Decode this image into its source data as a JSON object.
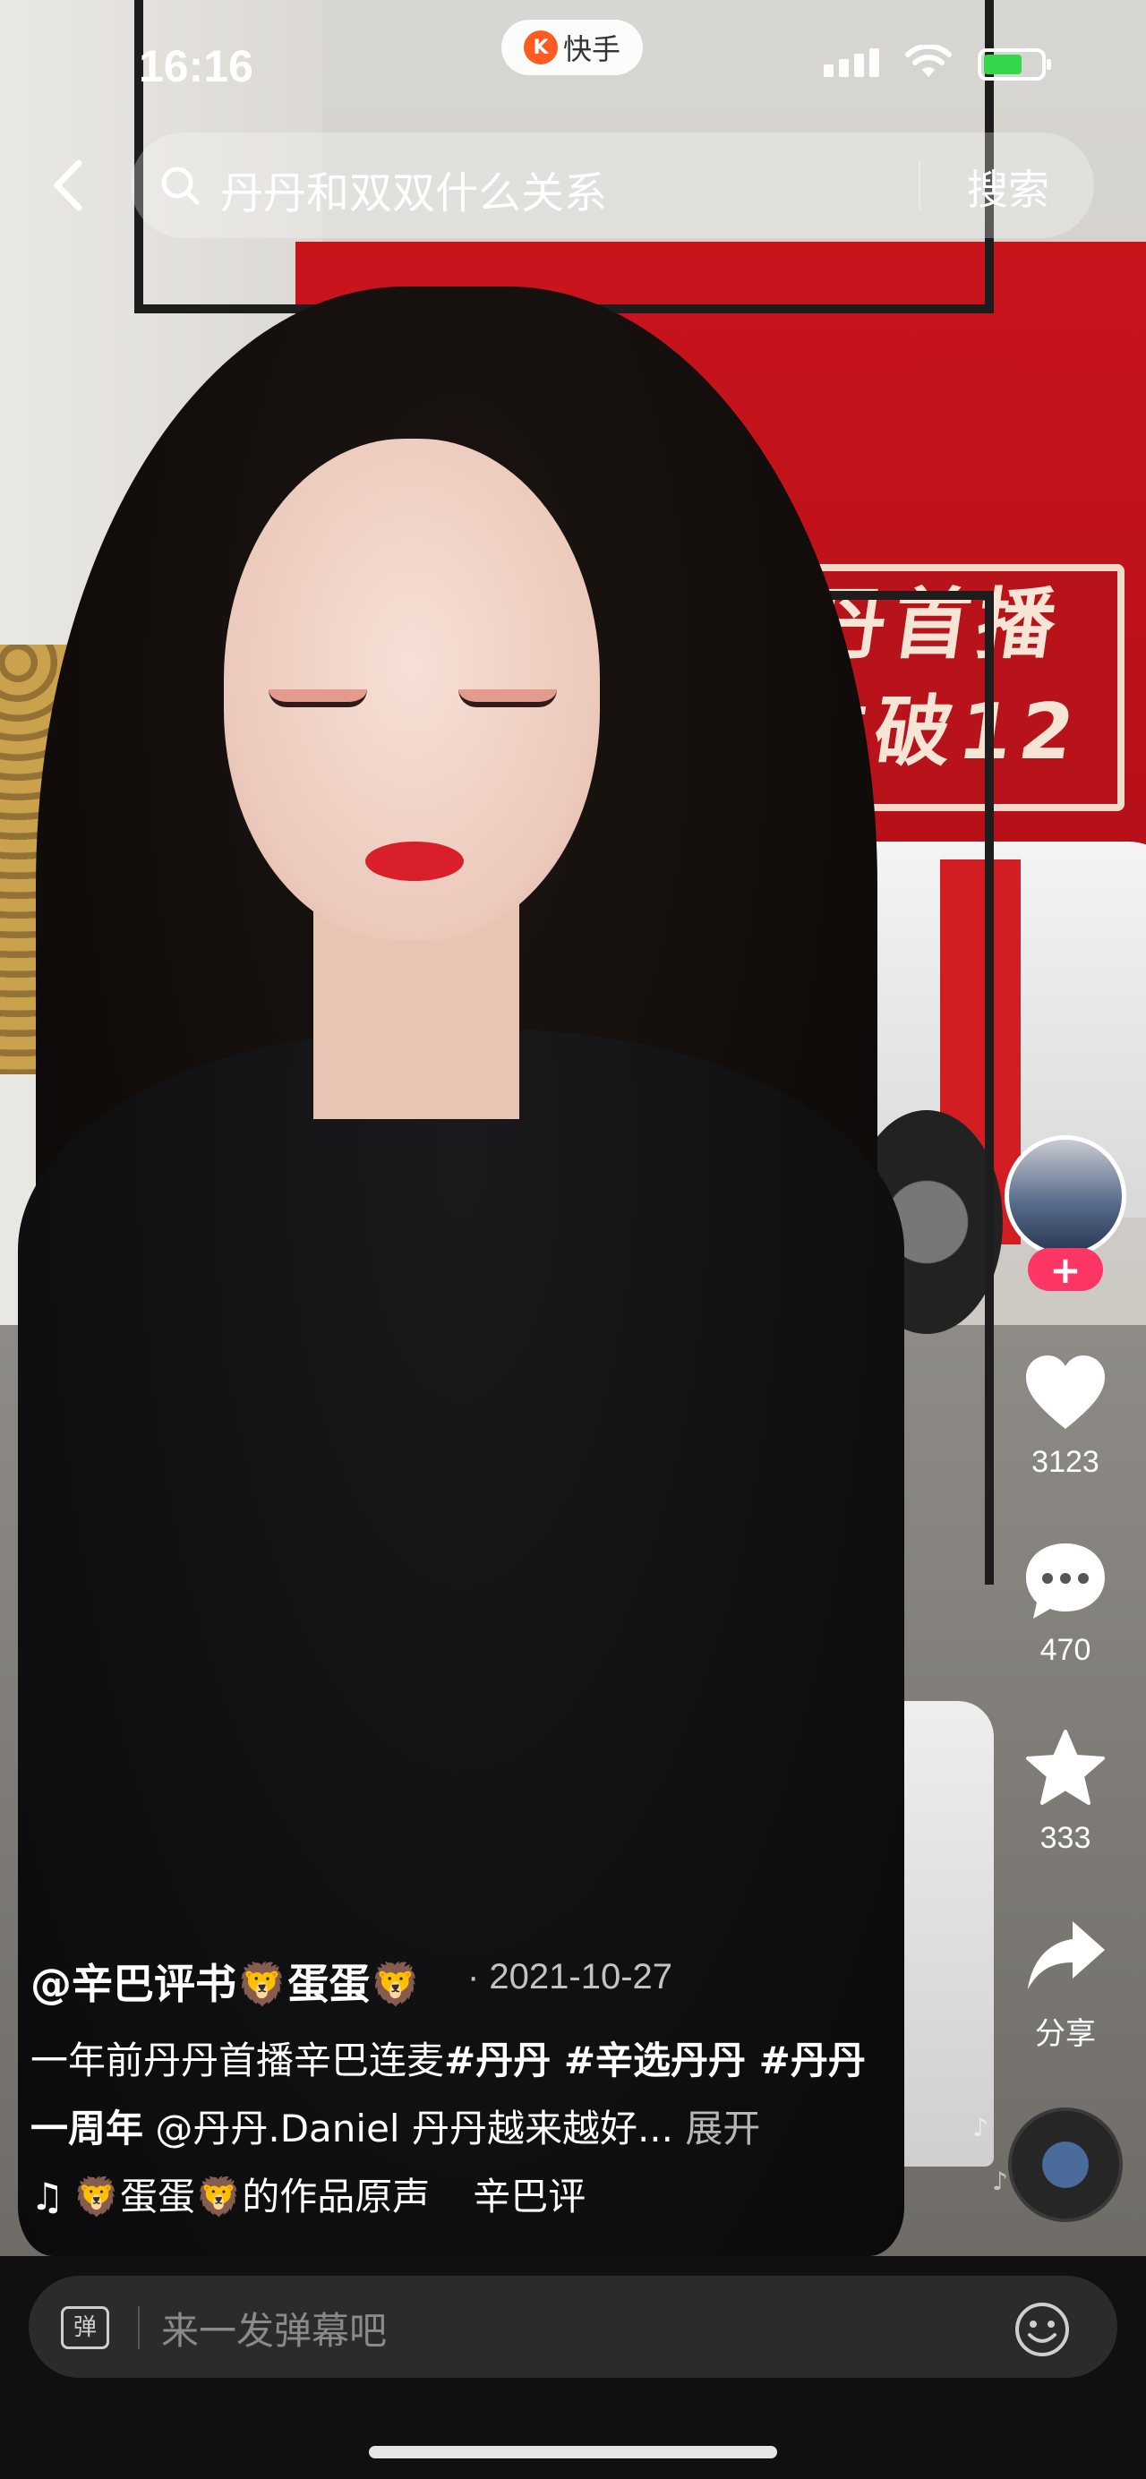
{
  "status_bar": {
    "time": "16:16",
    "app_name": "快手"
  },
  "search": {
    "query": "丹丹和双双什么关系",
    "button_label": "搜索"
  },
  "video_sign_text": {
    "line1": "丹丹首播",
    "line2": "排位破12"
  },
  "rail": {
    "likes": "3123",
    "comments": "470",
    "favorites": "333",
    "share_label": "分享"
  },
  "caption": {
    "author": "@辛巴评书🦁蛋蛋🦁",
    "date": "· 2021-10-27",
    "text_plain1": "一年前丹丹首播辛巴连麦",
    "tag1": "#丹丹 #辛选丹丹 #丹丹一周年",
    "text_plain2": " @丹丹.Daniel 丹丹越来越好...",
    "more_label": "展开"
  },
  "music": {
    "title": "🦁蛋蛋🦁的作品原声",
    "source": "辛巴评"
  },
  "comment_bar": {
    "danmu_icon_label": "弹",
    "placeholder": "来一发弹幕吧"
  },
  "colors": {
    "follow_button": "#fe3666",
    "battery_fill": "#32d74b",
    "app_logo": "#ff5a1f"
  }
}
